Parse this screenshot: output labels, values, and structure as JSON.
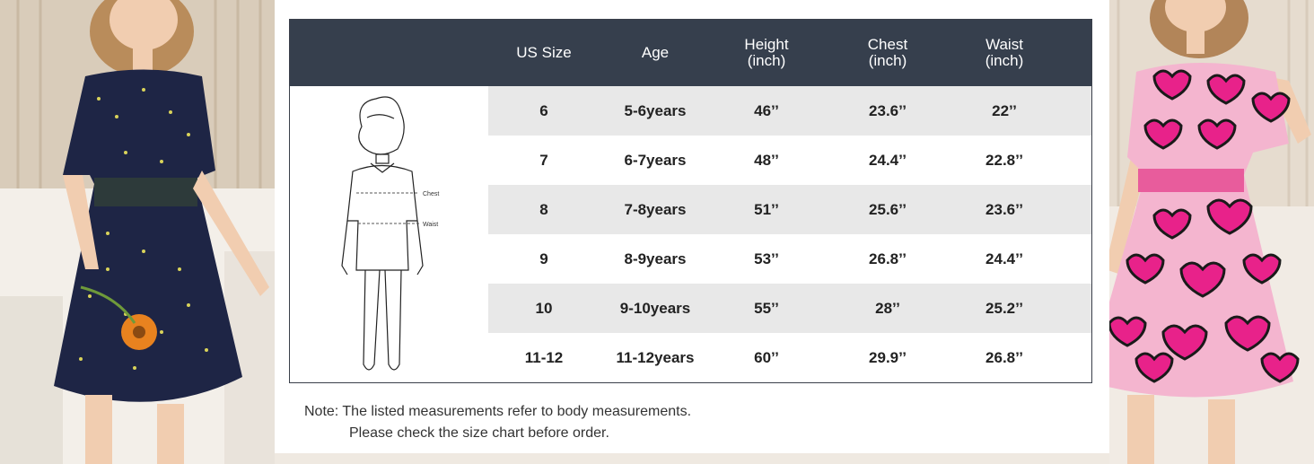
{
  "table": {
    "headers": {
      "us_size": "US Size",
      "age": "Age",
      "height": "Height",
      "height_unit": "(inch)",
      "chest": "Chest",
      "chest_unit": "(inch)",
      "waist": "Waist",
      "waist_unit": "(inch)"
    },
    "figure": {
      "chest_label": "Chest",
      "waist_label": "Waist"
    },
    "rows": [
      {
        "size": "6",
        "age": "5-6years",
        "height": "46’’",
        "chest": "23.6’’",
        "waist": "22’’"
      },
      {
        "size": "7",
        "age": "6-7years",
        "height": "48’’",
        "chest": "24.4’’",
        "waist": "22.8’’"
      },
      {
        "size": "8",
        "age": "7-8years",
        "height": "51’’",
        "chest": "25.6’’",
        "waist": "23.6’’"
      },
      {
        "size": "9",
        "age": "8-9years",
        "height": "53’’",
        "chest": "26.8’’",
        "waist": "24.4’’"
      },
      {
        "size": "10",
        "age": "9-10years",
        "height": "55’’",
        "chest": "28’’",
        "waist": "25.2’’"
      },
      {
        "size": "11-12",
        "age": "11-12years",
        "height": "60’’",
        "chest": "29.9’’",
        "waist": "26.8’’"
      }
    ]
  },
  "note": {
    "line1": "Note:  The listed measurements refer to body measurements.",
    "line2": "Please check the size chart before order."
  },
  "colors": {
    "header_bg": "#363f4d",
    "row_shade": "#e8e8e8",
    "navy_dress": "#1e2545",
    "pink_dress": "#f4b5cf",
    "heart_pink": "#e8228a"
  }
}
